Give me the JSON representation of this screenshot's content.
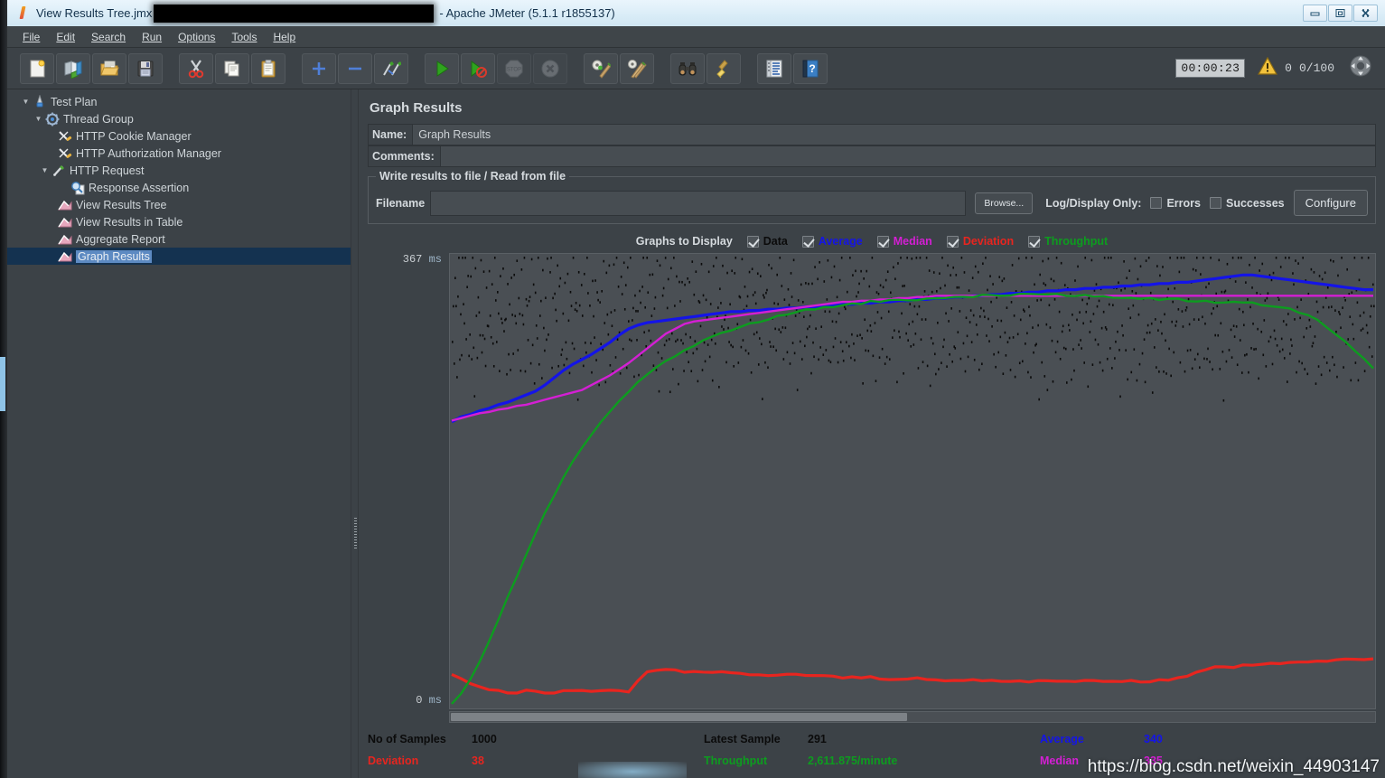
{
  "window": {
    "title_file": "View Results Tree.jmx",
    "title_app": "- Apache JMeter (5.1.1 r1855137)",
    "app_icon": "jmeter-feather-icon",
    "controls": [
      {
        "name": "minimize-button",
        "glyph": "minimize-icon"
      },
      {
        "name": "maximize-button",
        "glyph": "maximize-icon"
      },
      {
        "name": "close-button",
        "glyph": "close-icon"
      }
    ]
  },
  "menubar": {
    "items": [
      {
        "label": "File",
        "mnemonic": "F"
      },
      {
        "label": "Edit",
        "mnemonic": "E"
      },
      {
        "label": "Search",
        "mnemonic": "S"
      },
      {
        "label": "Run",
        "mnemonic": "R"
      },
      {
        "label": "Options",
        "mnemonic": "O"
      },
      {
        "label": "Tools",
        "mnemonic": "T"
      },
      {
        "label": "Help",
        "mnemonic": "H"
      }
    ]
  },
  "toolbar": {
    "buttons": [
      {
        "name": "new-button",
        "icon": "new-document-icon",
        "enabled": true
      },
      {
        "name": "templates-button",
        "icon": "templates-icon",
        "enabled": true
      },
      {
        "name": "open-button",
        "icon": "open-folder-icon",
        "enabled": true
      },
      {
        "name": "save-button",
        "icon": "floppy-disk-icon",
        "enabled": true
      },
      {
        "name": "cut-button",
        "icon": "scissors-icon",
        "enabled": true
      },
      {
        "name": "copy-button",
        "icon": "copy-icon",
        "enabled": true
      },
      {
        "name": "paste-button",
        "icon": "clipboard-icon",
        "enabled": true
      },
      {
        "name": "expand-all-button",
        "icon": "plus-icon",
        "enabled": true
      },
      {
        "name": "collapse-all-button",
        "icon": "minus-icon",
        "enabled": true
      },
      {
        "name": "toggle-button",
        "icon": "toggle-icon",
        "enabled": true
      },
      {
        "name": "start-button",
        "icon": "play-icon",
        "enabled": true
      },
      {
        "name": "start-no-pauses-button",
        "icon": "play-no-timers-icon",
        "enabled": true
      },
      {
        "name": "stop-button",
        "icon": "stop-icon",
        "enabled": false
      },
      {
        "name": "shutdown-button",
        "icon": "shutdown-icon",
        "enabled": false
      },
      {
        "name": "clear-button",
        "icon": "clear-broom-icon",
        "enabled": true
      },
      {
        "name": "clear-all-button",
        "icon": "clear-all-broom-icon",
        "enabled": true
      },
      {
        "name": "search-button",
        "icon": "binoculars-icon",
        "enabled": true
      },
      {
        "name": "reset-search-button",
        "icon": "reset-search-broom-icon",
        "enabled": true
      },
      {
        "name": "function-helper-button",
        "icon": "log-list-icon",
        "enabled": true
      },
      {
        "name": "help-button",
        "icon": "help-book-icon",
        "enabled": true
      }
    ],
    "timer": "00:00:23",
    "warning_icon": "warning-triangle-icon",
    "warning_count": "0",
    "thread_count": "0/100",
    "expand_icon": "expand-arrows-icon"
  },
  "tree": {
    "items": [
      {
        "label": "Test Plan",
        "depth": 0,
        "toggle": "down",
        "icon": "test-plan-icon",
        "selected": false
      },
      {
        "label": "Thread Group",
        "depth": 1,
        "toggle": "down",
        "icon": "thread-group-icon",
        "selected": false
      },
      {
        "label": "HTTP Cookie Manager",
        "depth": 2,
        "toggle": "none",
        "icon": "cookie-manager-icon",
        "selected": false
      },
      {
        "label": "HTTP Authorization Manager",
        "depth": 2,
        "toggle": "none",
        "icon": "auth-manager-icon",
        "selected": false
      },
      {
        "label": "HTTP Request",
        "depth": 2,
        "toggle": "down",
        "icon": "http-request-icon",
        "selected": false
      },
      {
        "label": "Response Assertion",
        "depth": 3,
        "toggle": "none",
        "icon": "assertion-icon",
        "selected": false
      },
      {
        "label": "View Results Tree",
        "depth": 2,
        "toggle": "none",
        "icon": "listener-icon",
        "selected": false
      },
      {
        "label": "View Results in Table",
        "depth": 2,
        "toggle": "none",
        "icon": "listener-icon",
        "selected": false
      },
      {
        "label": "Aggregate Report",
        "depth": 2,
        "toggle": "none",
        "icon": "listener-icon",
        "selected": false
      },
      {
        "label": "Graph Results",
        "depth": 2,
        "toggle": "none",
        "icon": "listener-icon",
        "selected": true
      }
    ]
  },
  "panel": {
    "title": "Graph Results",
    "name_label": "Name:",
    "name_value": "Graph Results",
    "comments_label": "Comments:",
    "comments_value": "",
    "fieldset_legend": "Write results to file / Read from file",
    "filename_label": "Filename",
    "filename_value": "",
    "browse_label": "Browse...",
    "logdisplay_label": "Log/Display Only:",
    "errors_label": "Errors",
    "errors_checked": false,
    "successes_label": "Successes",
    "successes_checked": false,
    "configure_label": "Configure"
  },
  "graphs_to_display": {
    "label": "Graphs to Display",
    "options": [
      {
        "label": "Data",
        "checked": true,
        "color": "#0b0b0b"
      },
      {
        "label": "Average",
        "checked": true,
        "color": "#1414e8"
      },
      {
        "label": "Median",
        "checked": true,
        "color": "#d41fd4"
      },
      {
        "label": "Deviation",
        "checked": true,
        "color": "#e8251f"
      },
      {
        "label": "Throughput",
        "checked": true,
        "color": "#0d9c1f"
      }
    ]
  },
  "axis": {
    "ymax_value": "367",
    "ymax_unit": "ms",
    "ymin_value": "0",
    "ymin_unit": "ms"
  },
  "stats": {
    "rows": [
      [
        {
          "key": "No of Samples",
          "value": "1000",
          "color": "black"
        },
        {
          "key": "Latest Sample",
          "value": "291",
          "color": "black"
        },
        {
          "key": "Average",
          "value": "340",
          "color": "blue"
        }
      ],
      [
        {
          "key": "Deviation",
          "value": "38",
          "color": "red"
        },
        {
          "key": "Throughput",
          "value": "2,611.875/minute",
          "color": "green"
        },
        {
          "key": "Median",
          "value": "335",
          "color": "magenta"
        }
      ]
    ]
  },
  "watermark": "https://blog.csdn.net/weixin_44903147",
  "chart_data": {
    "type": "line",
    "title": "Graph Results",
    "xlabel": "",
    "ylabel": "ms",
    "ylim": [
      0,
      367
    ],
    "grid": false,
    "legend": [
      "Data",
      "Average",
      "Median",
      "Deviation",
      "Throughput"
    ],
    "legend_position": "top",
    "series": [
      {
        "name": "Data",
        "color": "#0b0b0b",
        "style": "scatter",
        "note": "individual sample response times, scattered 230-367 ms band",
        "values": [
          300,
          330,
          290,
          355,
          312,
          276,
          340,
          361,
          295,
          318,
          282,
          349,
          333,
          301,
          367,
          288,
          325,
          347,
          279,
          310,
          336,
          293,
          358,
          304,
          271,
          342,
          319,
          287,
          353,
          326,
          298,
          362,
          281,
          315,
          339,
          305,
          268,
          350,
          322,
          294,
          357,
          331,
          285,
          346,
          309,
          277,
          363,
          328,
          297,
          341,
          313,
          283,
          354,
          320,
          302,
          365,
          290,
          334,
          317,
          275,
          348,
          306,
          329,
          292,
          359,
          311,
          280,
          343,
          323,
          299,
          356,
          286,
          337,
          308,
          272,
          351,
          327,
          303,
          360,
          289,
          332,
          316,
          284,
          345,
          321,
          296,
          364,
          307,
          338,
          278,
          352,
          314,
          300,
          366,
          291,
          324,
          335,
          287,
          349,
          310
        ]
      },
      {
        "name": "Average",
        "color": "#1414e8",
        "style": "line",
        "note": "running average rises from ~230 ms to plateau ~345 ms",
        "values": [
          232,
          236,
          238,
          241,
          243,
          246,
          248,
          251,
          254,
          257,
          262,
          268,
          274,
          279,
          283,
          287,
          292,
          297,
          303,
          308,
          311,
          313,
          314,
          315,
          316,
          317,
          318,
          319,
          320,
          321,
          322,
          322,
          323,
          323,
          324,
          324,
          325,
          325,
          326,
          326,
          327,
          327,
          328,
          328,
          329,
          329,
          330,
          330,
          331,
          331,
          332,
          332,
          333,
          333,
          334,
          334,
          335,
          335,
          336,
          336,
          337,
          337,
          338,
          338,
          339,
          339,
          340,
          340,
          341,
          341,
          342,
          342,
          343,
          343,
          344,
          344,
          345,
          345,
          346,
          346,
          347,
          348,
          349,
          350,
          351,
          352,
          352,
          351,
          350,
          349,
          348,
          347,
          346,
          345,
          344,
          343,
          342,
          341,
          340,
          340
        ]
      },
      {
        "name": "Median",
        "color": "#d41fd4",
        "style": "line",
        "note": "running median, slightly below average, plateaus ~335 ms",
        "values": [
          233,
          235,
          237,
          239,
          240,
          242,
          243,
          245,
          246,
          248,
          250,
          252,
          254,
          256,
          258,
          262,
          266,
          270,
          275,
          280,
          286,
          292,
          298,
          304,
          308,
          312,
          314,
          315,
          316,
          317,
          318,
          319,
          320,
          321,
          322,
          323,
          324,
          325,
          326,
          327,
          328,
          329,
          330,
          330,
          331,
          331,
          332,
          332,
          333,
          333,
          334,
          334,
          335,
          335,
          335,
          335,
          335,
          335,
          335,
          335,
          335,
          335,
          335,
          335,
          335,
          335,
          335,
          335,
          335,
          335,
          335,
          335,
          335,
          335,
          335,
          335,
          335,
          335,
          335,
          335,
          335,
          335,
          335,
          335,
          335,
          335,
          335,
          335,
          335,
          335,
          335,
          335,
          335,
          335,
          335,
          335,
          335,
          335,
          335,
          335
        ]
      },
      {
        "name": "Deviation",
        "color": "#e8251f",
        "style": "line",
        "note": "standard deviation, low band near 10-30 ms, small early dip then rise",
        "values": [
          26,
          22,
          18,
          15,
          13,
          12,
          11,
          11,
          12,
          12,
          11,
          11,
          12,
          13,
          13,
          12,
          12,
          12,
          12,
          12,
          20,
          27,
          29,
          29,
          29,
          28,
          28,
          28,
          27,
          27,
          27,
          26,
          26,
          26,
          25,
          25,
          25,
          25,
          24,
          24,
          24,
          24,
          23,
          23,
          23,
          23,
          22,
          22,
          22,
          22,
          22,
          21,
          21,
          21,
          21,
          21,
          21,
          20,
          20,
          20,
          20,
          20,
          20,
          20,
          20,
          20,
          20,
          20,
          20,
          20,
          20,
          20,
          20,
          20,
          20,
          20,
          21,
          21,
          22,
          24,
          27,
          30,
          31,
          32,
          32,
          33,
          33,
          34,
          34,
          35,
          35,
          36,
          36,
          37,
          37,
          37,
          38,
          38,
          38,
          38
        ]
      },
      {
        "name": "Throughput",
        "color": "#0d9c1f",
        "style": "line",
        "note": "throughput climbs steeply then saturates near top of plot, slight decline at end",
        "values": [
          2,
          10,
          22,
          36,
          52,
          70,
          88,
          106,
          124,
          141,
          157,
          172,
          186,
          199,
          211,
          222,
          232,
          241,
          249,
          257,
          264,
          270,
          276,
          281,
          286,
          290,
          294,
          298,
          301,
          304,
          307,
          310,
          312,
          314,
          316,
          318,
          320,
          321,
          323,
          324,
          325,
          326,
          327,
          328,
          329,
          330,
          330,
          331,
          331,
          332,
          332,
          333,
          333,
          333,
          334,
          334,
          334,
          335,
          335,
          335,
          335,
          336,
          336,
          336,
          336,
          336,
          335,
          335,
          335,
          335,
          334,
          334,
          334,
          333,
          333,
          333,
          332,
          332,
          332,
          331,
          331,
          331,
          330,
          330,
          330,
          329,
          329,
          328,
          327,
          326,
          324,
          322,
          319,
          315,
          310,
          304,
          298,
          291,
          284,
          276
        ]
      }
    ]
  }
}
